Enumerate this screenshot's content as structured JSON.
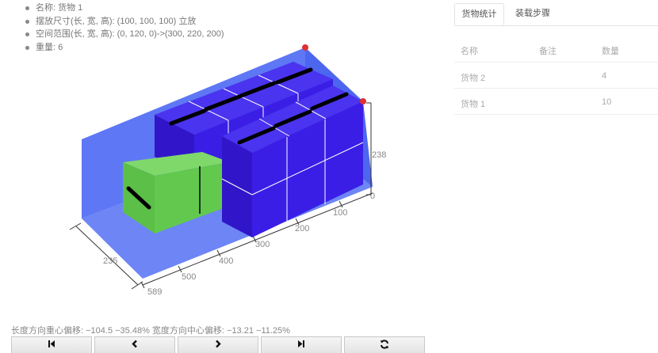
{
  "info": [
    "名称: 货物 1",
    "摆放尺寸(长, 宽, 高): (100, 100, 100) 立放",
    "空间范围(长, 宽, 高): (0, 120, 0)->(300, 220, 200)",
    "重量: 6"
  ],
  "axes": {
    "height_labels": [
      "238",
      "0"
    ],
    "length_labels": [
      "100",
      "200",
      "300",
      "400",
      "500",
      "589"
    ],
    "width_label": "235"
  },
  "stats": "长度方向重心偏移: −104.5 −35.48% 宽度方向中心偏移: −13.21 −11.25%",
  "toolbar": [
    {
      "icon": "skip-first-icon",
      "name": "first-step-button"
    },
    {
      "icon": "chevron-left-icon",
      "name": "prev-step-button"
    },
    {
      "icon": "chevron-right-icon",
      "name": "next-step-button"
    },
    {
      "icon": "skip-last-icon",
      "name": "last-step-button"
    },
    {
      "icon": "refresh-icon",
      "name": "reset-button"
    }
  ],
  "tabs": [
    "货物统计",
    "装载步骤"
  ],
  "table": {
    "headers": [
      "名称",
      "备注",
      "数量"
    ],
    "rows": [
      {
        "name": "货物 2",
        "note": "",
        "qty": "4"
      },
      {
        "name": "货物 1",
        "note": "",
        "qty": "10"
      }
    ]
  },
  "colors": {
    "container": "#5e77f5",
    "box_blue": "#3a1ee6",
    "box_green": "#62c94e",
    "corner_marker": "#e03030"
  }
}
